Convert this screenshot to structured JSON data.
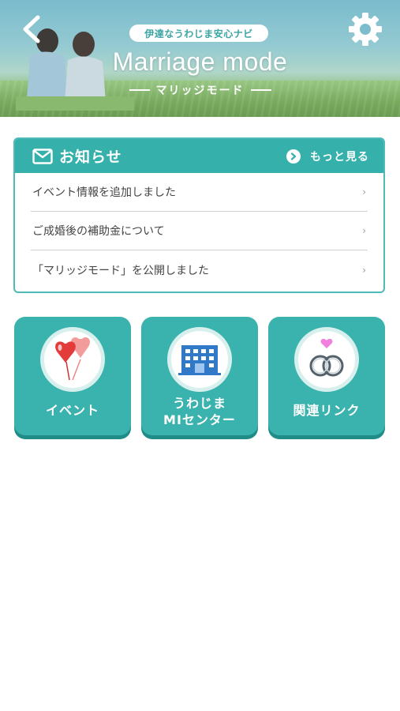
{
  "header": {
    "pill_text": "伊達なうわじま安心ナビ",
    "title": "Marriage mode",
    "subtitle": "マリッジモード"
  },
  "notice": {
    "title": "お知らせ",
    "more_label": "もっと見る",
    "items": [
      {
        "label": "イベント情報を追加しました"
      },
      {
        "label": "ご成婚後の補助金について"
      },
      {
        "label": "「マリッジモード」を公開しました"
      }
    ]
  },
  "tiles": [
    {
      "label_line1": "イベント",
      "label_line2": "",
      "icon": "balloons-icon"
    },
    {
      "label_line1": "うわじま",
      "label_line2": "MIセンター",
      "icon": "building-icon"
    },
    {
      "label_line1": "関連リンク",
      "label_line2": "",
      "icon": "rings-icon"
    }
  ],
  "colors": {
    "accent": "#35b0ab",
    "tile_shadow": "#1f8c88",
    "pill_text": "#3ba6a3"
  }
}
